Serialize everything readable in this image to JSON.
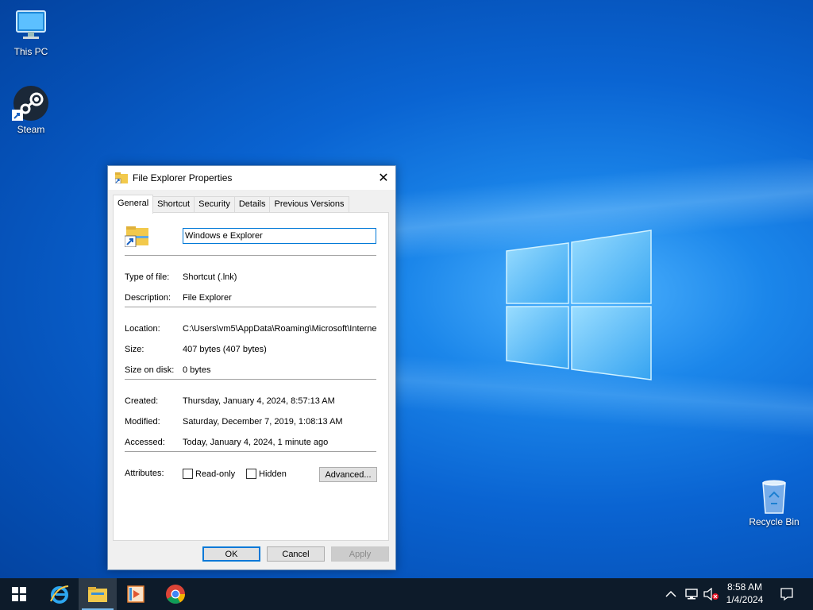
{
  "desktop": {
    "icons": [
      {
        "label": "This PC"
      },
      {
        "label": "Steam"
      },
      {
        "label": "Recycle Bin"
      }
    ]
  },
  "dialog": {
    "title": "File Explorer Properties",
    "tabs": [
      "General",
      "Shortcut",
      "Security",
      "Details",
      "Previous Versions"
    ],
    "active_tab": "General",
    "name_value": "Windows e Explorer",
    "fields": {
      "type_label": "Type of file:",
      "type_value": "Shortcut (.lnk)",
      "desc_label": "Description:",
      "desc_value": "File Explorer",
      "location_label": "Location:",
      "location_value": "C:\\Users\\vm5\\AppData\\Roaming\\Microsoft\\Interne",
      "size_label": "Size:",
      "size_value": "407 bytes (407 bytes)",
      "disk_label": "Size on disk:",
      "disk_value": "0 bytes",
      "created_label": "Created:",
      "created_value": "Thursday, January 4, 2024, 8:57:13 AM",
      "modified_label": "Modified:",
      "modified_value": "Saturday, December 7, 2019, 1:08:13 AM",
      "accessed_label": "Accessed:",
      "accessed_value": "Today, January 4, 2024, 1 minute ago",
      "attributes_label": "Attributes:"
    },
    "checkboxes": {
      "readonly_label": "Read-only",
      "readonly_checked": false,
      "hidden_label": "Hidden",
      "hidden_checked": false
    },
    "buttons": {
      "advanced": "Advanced...",
      "ok": "OK",
      "cancel": "Cancel",
      "apply": "Apply"
    }
  },
  "taskbar": {
    "pinned": [
      "start-icon",
      "internet-explorer-icon",
      "file-explorer-icon",
      "media-player-icon",
      "chrome-icon"
    ],
    "active": "file-explorer-icon",
    "clock_time": "8:58 AM",
    "clock_date": "1/4/2024"
  },
  "colors": {
    "accent": "#0078d7",
    "taskbar": "#0d1b2a"
  }
}
